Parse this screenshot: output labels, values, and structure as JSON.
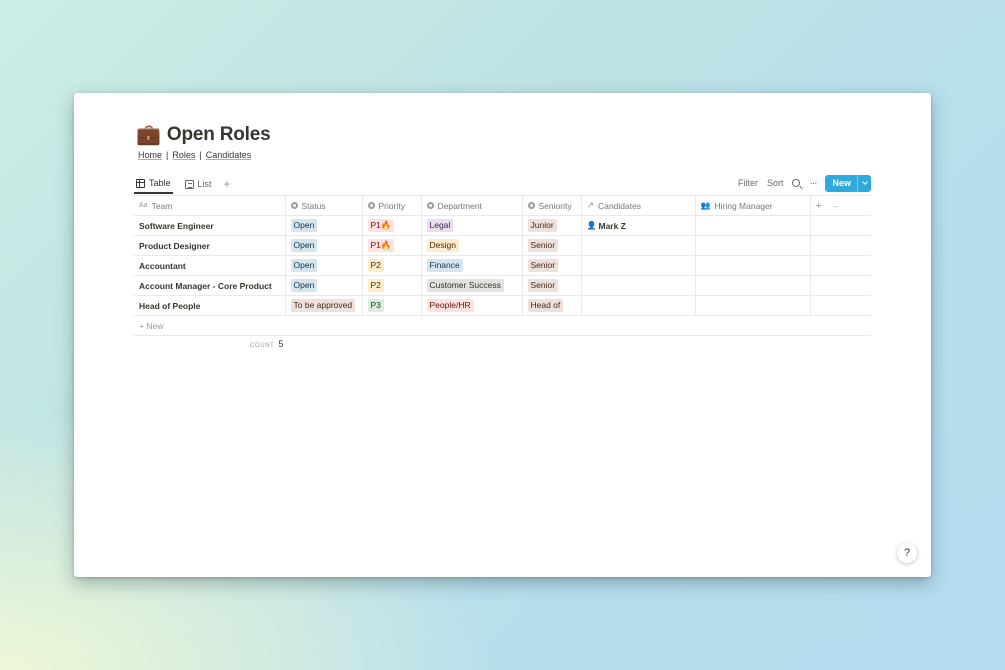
{
  "page": {
    "icon": "💼",
    "title": "Open Roles",
    "breadcrumb": [
      "Home",
      "Roles",
      "Candidates"
    ],
    "breadcrumb_sep": "|"
  },
  "views": {
    "tabs": [
      {
        "label": "Table",
        "icon": "table-icon",
        "active": true
      },
      {
        "label": "List",
        "icon": "list-icon",
        "active": false
      }
    ],
    "add": "+"
  },
  "toolbar": {
    "filter": "Filter",
    "sort": "Sort",
    "more": "···",
    "new": "New"
  },
  "table": {
    "columns": [
      {
        "label": "Team",
        "icon": "text-property-icon"
      },
      {
        "label": "Status",
        "icon": "select-property-icon"
      },
      {
        "label": "Priority",
        "icon": "select-property-icon"
      },
      {
        "label": "Department",
        "icon": "select-property-icon"
      },
      {
        "label": "Seniority",
        "icon": "select-property-icon"
      },
      {
        "label": "Candidates",
        "icon": "relation-arrow-icon"
      },
      {
        "label": "Hiring Manager",
        "icon": "person-property-icon"
      }
    ],
    "add_column": "+",
    "column_more": "···",
    "header_icon_text": "Aa",
    "rows": [
      {
        "team": "Software Engineer",
        "status": "Open",
        "priority": "P1🔥",
        "department": "Legal",
        "seniority": "Junior",
        "candidates": "Mark Z"
      },
      {
        "team": "Product Designer",
        "status": "Open",
        "priority": "P1🔥",
        "department": "Design",
        "seniority": "Senior",
        "candidates": ""
      },
      {
        "team": "Accountant",
        "status": "Open",
        "priority": "P2",
        "department": "Finance",
        "seniority": "Senior",
        "candidates": ""
      },
      {
        "team": "Account Manager - Core Product",
        "status": "Open",
        "priority": "P2",
        "department": "Customer Success",
        "seniority": "Senior",
        "candidates": ""
      },
      {
        "team": "Head of People",
        "status": "To be approved",
        "priority": "P3",
        "department": "People/HR",
        "seniority": "Head of",
        "candidates": ""
      }
    ],
    "new_row": "+ New",
    "count_label": "COUNT",
    "count_value": "5"
  },
  "colors": {
    "new_button": "#2eaadc",
    "tag_blue": "#d3e5ef",
    "tag_red": "#ffe2dd",
    "tag_purple": "#e8deee",
    "tag_yellow": "#fdecc8",
    "tag_brown": "#eee0da",
    "tag_gray": "#e3e2e0",
    "tag_green": "#dbeddb"
  },
  "help": "?"
}
